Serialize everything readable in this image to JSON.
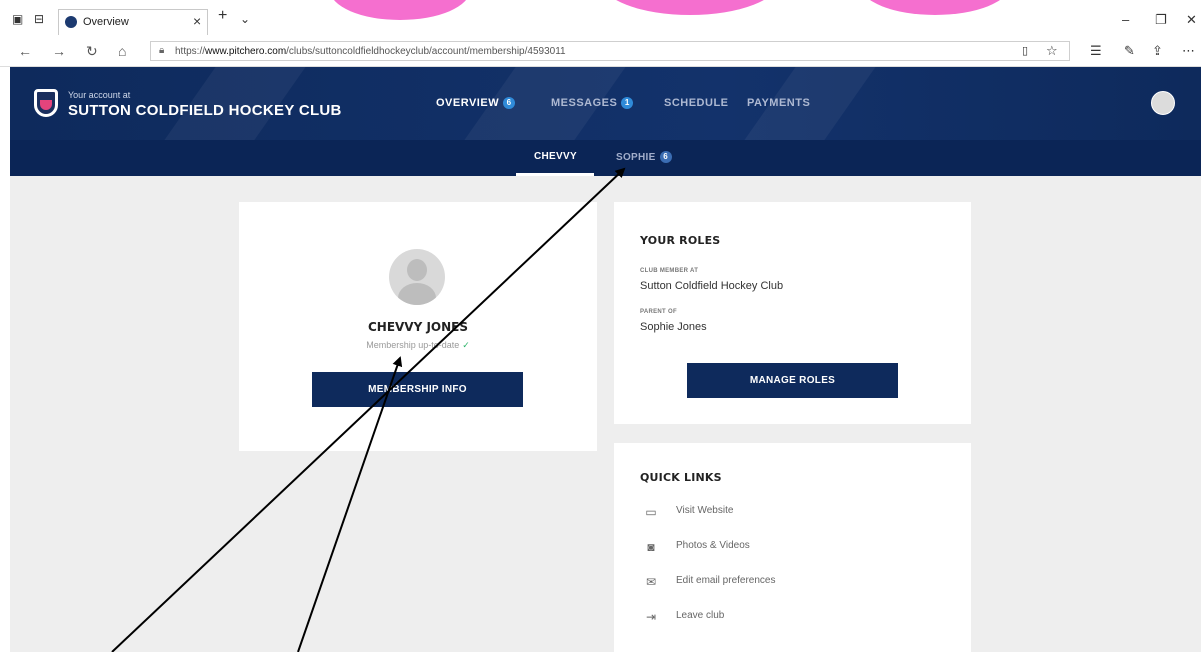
{
  "browser": {
    "tab_title": "Overview",
    "url_prefix": "https://",
    "url_domain": "www.pitchero.com",
    "url_path": "/clubs/suttoncoldfieldhockeyclub/account/membership/4593011"
  },
  "header": {
    "account_at": "Your account at",
    "club_name": "SUTTON COLDFIELD HOCKEY CLUB",
    "nav": [
      {
        "label": "OVERVIEW",
        "badge": "6"
      },
      {
        "label": "MESSAGES",
        "badge": "1"
      },
      {
        "label": "SCHEDULE"
      },
      {
        "label": "PAYMENTS"
      }
    ]
  },
  "subnav": {
    "tabs": [
      {
        "label": "CHEVVY"
      },
      {
        "label": "SOPHIE",
        "badge": "6"
      }
    ]
  },
  "profile": {
    "name": "CHEVVY JONES",
    "status": "Membership up-to-date",
    "button": "MEMBERSHIP INFO"
  },
  "roles": {
    "heading": "YOUR ROLES",
    "items": [
      {
        "label": "CLUB MEMBER AT",
        "value": "Sutton Coldfield Hockey Club"
      },
      {
        "label": "PARENT OF",
        "value": "Sophie Jones"
      }
    ],
    "button": "MANAGE ROLES"
  },
  "quick_links": {
    "heading": "QUICK LINKS",
    "items": [
      {
        "label": "Visit Website",
        "icon": "window-icon"
      },
      {
        "label": "Photos & Videos",
        "icon": "camera-icon"
      },
      {
        "label": "Edit email preferences",
        "icon": "envelope-icon"
      },
      {
        "label": "Leave club",
        "icon": "exit-icon"
      }
    ]
  },
  "colors": {
    "header_navy": "#0e2a5c",
    "badge_blue": "#2f8ad8",
    "content_bg": "#eeeeee",
    "decor_pink": "#f56fcf"
  }
}
